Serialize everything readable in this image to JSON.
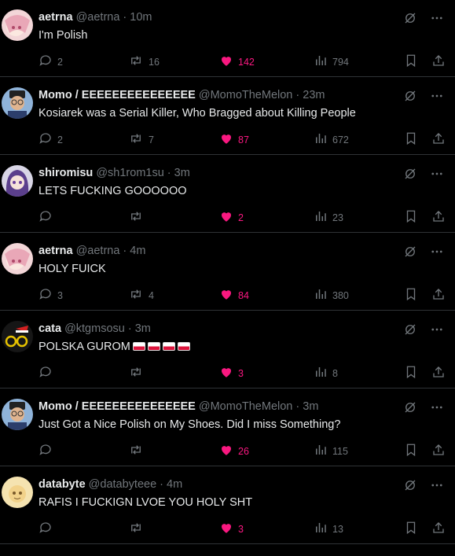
{
  "posts": [
    {
      "display_name": "aetrna",
      "handle": "@aetrna",
      "time": "10m",
      "text": "I'm Polish",
      "replies": "2",
      "reposts": "16",
      "likes": "142",
      "views": "794",
      "avatar": "pink-anime-avatar",
      "flags": 0
    },
    {
      "display_name": "Momo / EEEEEEEEEEEEEEE",
      "handle": "@MomoTheMelon",
      "time": "23m",
      "text": "Kosiarek was a Serial Killer, Who Bragged about Killing People",
      "replies": "2",
      "reposts": "7",
      "likes": "87",
      "views": "672",
      "avatar": "gentleman-avatar",
      "flags": 0
    },
    {
      "display_name": "shiromisu",
      "handle": "@sh1rom1su",
      "time": "3m",
      "text": "LETS FUCKING GOOOOOO",
      "replies": "",
      "reposts": "",
      "likes": "2",
      "views": "23",
      "avatar": "purple-hair-avatar",
      "flags": 0
    },
    {
      "display_name": "aetrna",
      "handle": "@aetrna",
      "time": "4m",
      "text": "HOLY FUICK",
      "replies": "3",
      "reposts": "4",
      "likes": "84",
      "views": "380",
      "avatar": "pink-anime-avatar",
      "flags": 0
    },
    {
      "display_name": "cata",
      "handle": "@ktgmsosu",
      "time": "3m",
      "text": "POLSKA GUROM",
      "replies": "",
      "reposts": "",
      "likes": "3",
      "views": "8",
      "avatar": "santa-hat-avatar",
      "flags": 4
    },
    {
      "display_name": "Momo / EEEEEEEEEEEEEEE",
      "handle": "@MomoTheMelon",
      "time": "3m",
      "text": "Just Got a Nice Polish on My Shoes. Did I miss Something?",
      "replies": "",
      "reposts": "",
      "likes": "26",
      "views": "115",
      "avatar": "gentleman-avatar",
      "flags": 0
    },
    {
      "display_name": "databyte",
      "handle": "@databyteee",
      "time": "4m",
      "text": "RAFIS I FUCKIGN LVOE YOU HOLY SHT",
      "replies": "",
      "reposts": "",
      "likes": "3",
      "views": "13",
      "avatar": "blonde-avatar",
      "flags": 0
    }
  ],
  "separator": "·",
  "colors": {
    "background": "#000000",
    "text": "#e7e9ea",
    "muted": "#71767b",
    "like": "#f91880",
    "divider": "#2f3336"
  },
  "icons": [
    "grok-slash-icon",
    "more-icon",
    "reply-icon",
    "repost-icon",
    "heart-icon",
    "views-icon",
    "bookmark-icon",
    "share-icon",
    "poland-flag-icon"
  ]
}
